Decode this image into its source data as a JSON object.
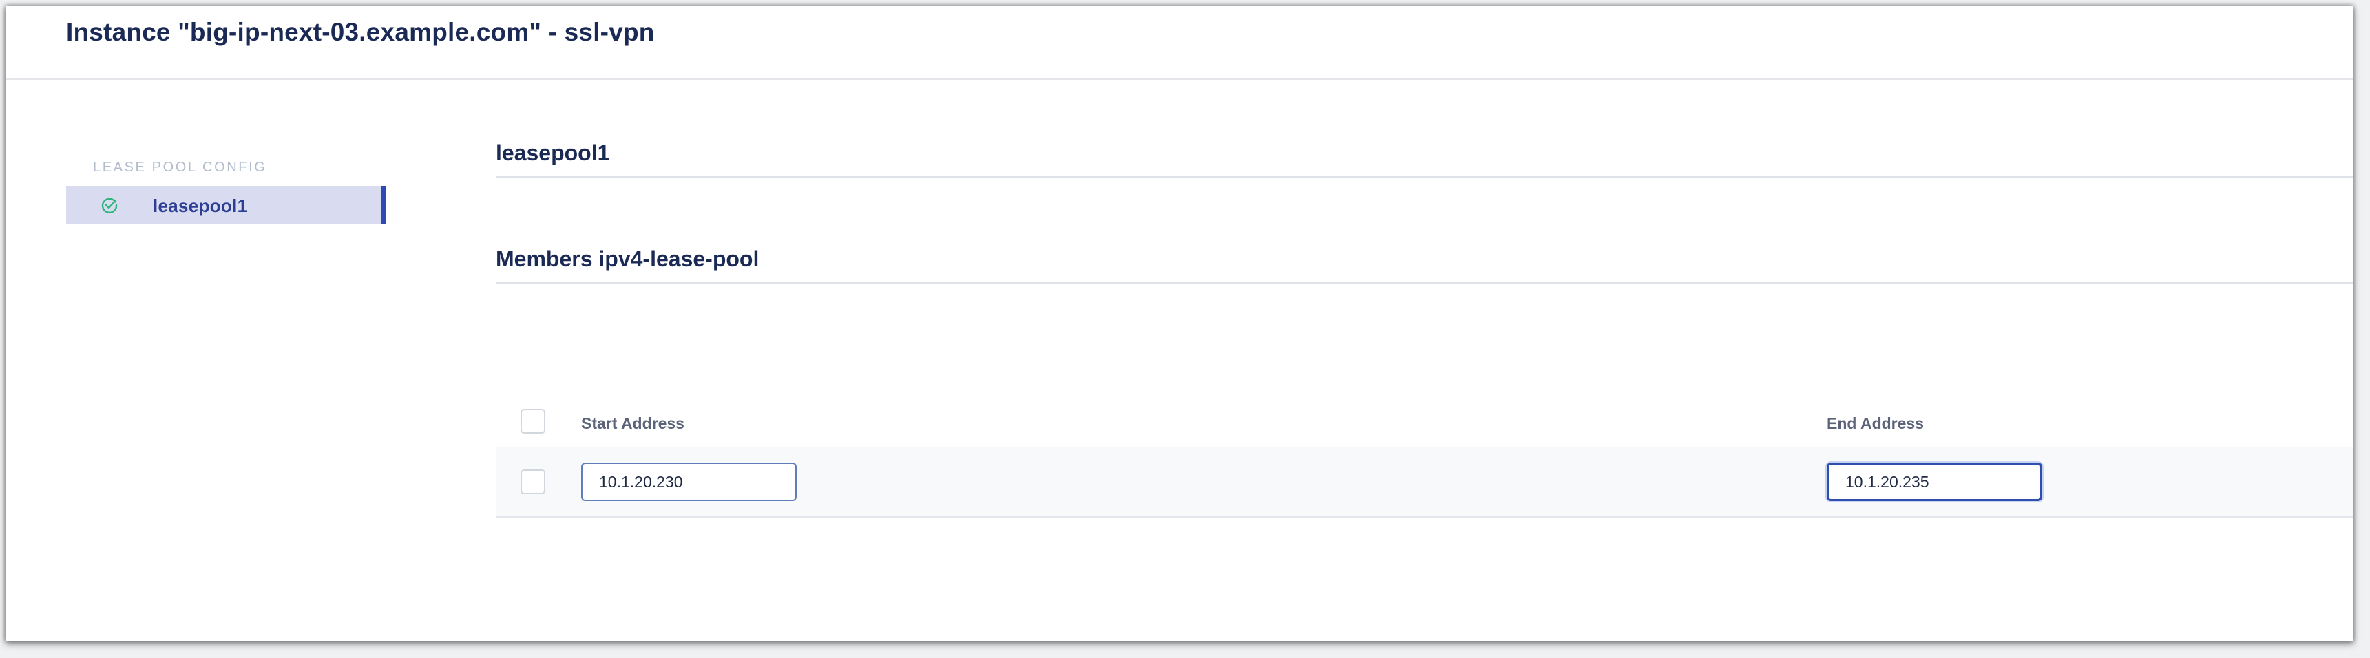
{
  "header": {
    "title": "Instance \"big-ip-next-03.example.com\" - ssl-vpn"
  },
  "sidebar": {
    "heading": "LEASE POOL CONFIG",
    "items": [
      {
        "label": "leasepool1",
        "status": "valid",
        "icon": "check-circle-icon",
        "selected": true
      }
    ]
  },
  "main": {
    "pool_title": "leasepool1",
    "members_title": "Members ipv4-lease-pool",
    "table": {
      "columns": [
        "Start Address",
        "End Address"
      ],
      "rows": [
        {
          "start": "10.1.20.230",
          "end": "10.1.20.235"
        }
      ]
    }
  },
  "colors": {
    "accent": "#2d4ab4",
    "selected_bg": "#d9dcf0",
    "valid_green": "#2fb67c",
    "title_text": "#1b2a55"
  }
}
